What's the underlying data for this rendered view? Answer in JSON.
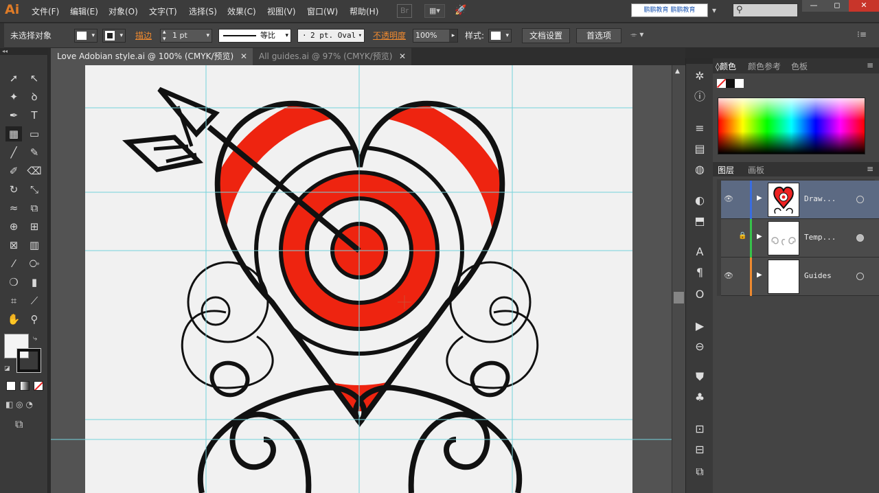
{
  "app": {
    "logo": "Ai"
  },
  "menu": [
    "文件(F)",
    "编辑(E)",
    "对象(O)",
    "文字(T)",
    "选择(S)",
    "效果(C)",
    "视图(V)",
    "窗口(W)",
    "帮助(H)"
  ],
  "topbar": {
    "bridge_label": "Br",
    "brand_left": "鹏鹏教育",
    "brand_right": "鹏鹏教育"
  },
  "window_controls": {
    "minimize": "—",
    "restore": "◻",
    "close": "✕"
  },
  "control_bar": {
    "selection_status": "未选择对象",
    "stroke_label": "描边",
    "stroke_weight": "1 pt",
    "stroke_profile": "等比",
    "brush": "2 pt. Oval",
    "opacity_label": "不透明度",
    "opacity_value": "100%",
    "style_label": "样式:",
    "doc_setup": "文档设置",
    "preferences": "首选项"
  },
  "tabs": [
    {
      "label": "Love Adobian style.ai @ 100% (CMYK/预览)",
      "active": true
    },
    {
      "label": "All guides.ai @ 97% (CMYK/预览)",
      "active": false
    }
  ],
  "tools": [
    {
      "name": "selection-tool",
      "glyph": "➚"
    },
    {
      "name": "direct-selection-tool",
      "glyph": "↖"
    },
    {
      "name": "magic-wand-tool",
      "glyph": "✦"
    },
    {
      "name": "lasso-tool",
      "glyph": "ꝺ"
    },
    {
      "name": "pen-tool",
      "glyph": "✒"
    },
    {
      "name": "type-tool",
      "glyph": "T"
    },
    {
      "name": "grid-tool",
      "glyph": "▦"
    },
    {
      "name": "rectangle-tool",
      "glyph": "▭"
    },
    {
      "name": "paintbrush-tool",
      "glyph": "╱"
    },
    {
      "name": "pencil-tool",
      "glyph": "✎"
    },
    {
      "name": "blob-brush-tool",
      "glyph": "✐"
    },
    {
      "name": "eraser-tool",
      "glyph": "⌫"
    },
    {
      "name": "rotate-tool",
      "glyph": "↻"
    },
    {
      "name": "scale-tool",
      "glyph": "⤡"
    },
    {
      "name": "warp-tool",
      "glyph": "≈"
    },
    {
      "name": "free-transform-tool",
      "glyph": "⧉"
    },
    {
      "name": "shape-builder-tool",
      "glyph": "⊕"
    },
    {
      "name": "perspective-grid-tool",
      "glyph": "⊞"
    },
    {
      "name": "mesh-tool",
      "glyph": "⊠"
    },
    {
      "name": "gradient-tool",
      "glyph": "▥"
    },
    {
      "name": "eyedropper-tool",
      "glyph": "⁄"
    },
    {
      "name": "blend-tool",
      "glyph": "⧂"
    },
    {
      "name": "symbol-sprayer-tool",
      "glyph": "❍"
    },
    {
      "name": "column-graph-tool",
      "glyph": "▮"
    },
    {
      "name": "artboard-tool",
      "glyph": "⌗"
    },
    {
      "name": "slice-tool",
      "glyph": "⟋"
    },
    {
      "name": "hand-tool",
      "glyph": "✋"
    },
    {
      "name": "zoom-tool",
      "glyph": "⚲"
    }
  ],
  "dock_icons": [
    "asterisk-icon",
    "info-icon",
    "align-icon",
    "gradient-swatch-icon",
    "transparency-icon",
    "appearance-icon",
    "graphic-styles-icon",
    "character-icon",
    "paragraph-icon",
    "opentype-icon",
    "actions-icon",
    "links-icon",
    "brushes-icon",
    "symbols-icon",
    "transform-icon",
    "pathfinder-icon",
    "artboards-icon"
  ],
  "dock_glyphs": [
    "✲",
    "ⓘ",
    "≡",
    "▤",
    "◍",
    "◐",
    "⬒",
    "A",
    "¶",
    "O",
    "▶",
    "⊖",
    "⛊",
    "♣",
    "⊡",
    "⊟",
    "⧉"
  ],
  "color_panel": {
    "tabs": [
      "颜色",
      "颜色参考",
      "色板"
    ],
    "active_tab": "颜色"
  },
  "layers_panel": {
    "tabs": [
      "图层",
      "画板"
    ],
    "layers": [
      {
        "name": "Draw...",
        "color": "#3a6de0",
        "visible": true,
        "locked": false,
        "selected": true
      },
      {
        "name": "Temp...",
        "color": "#37c24b",
        "visible": false,
        "locked": true,
        "selected": false
      },
      {
        "name": "Guides",
        "color": "#f08a2f",
        "visible": true,
        "locked": false,
        "selected": false
      }
    ]
  },
  "colors": {
    "heart_red": "#ee2410",
    "guide_cyan": "#74d3dc",
    "accent_orange": "#e07c27"
  }
}
